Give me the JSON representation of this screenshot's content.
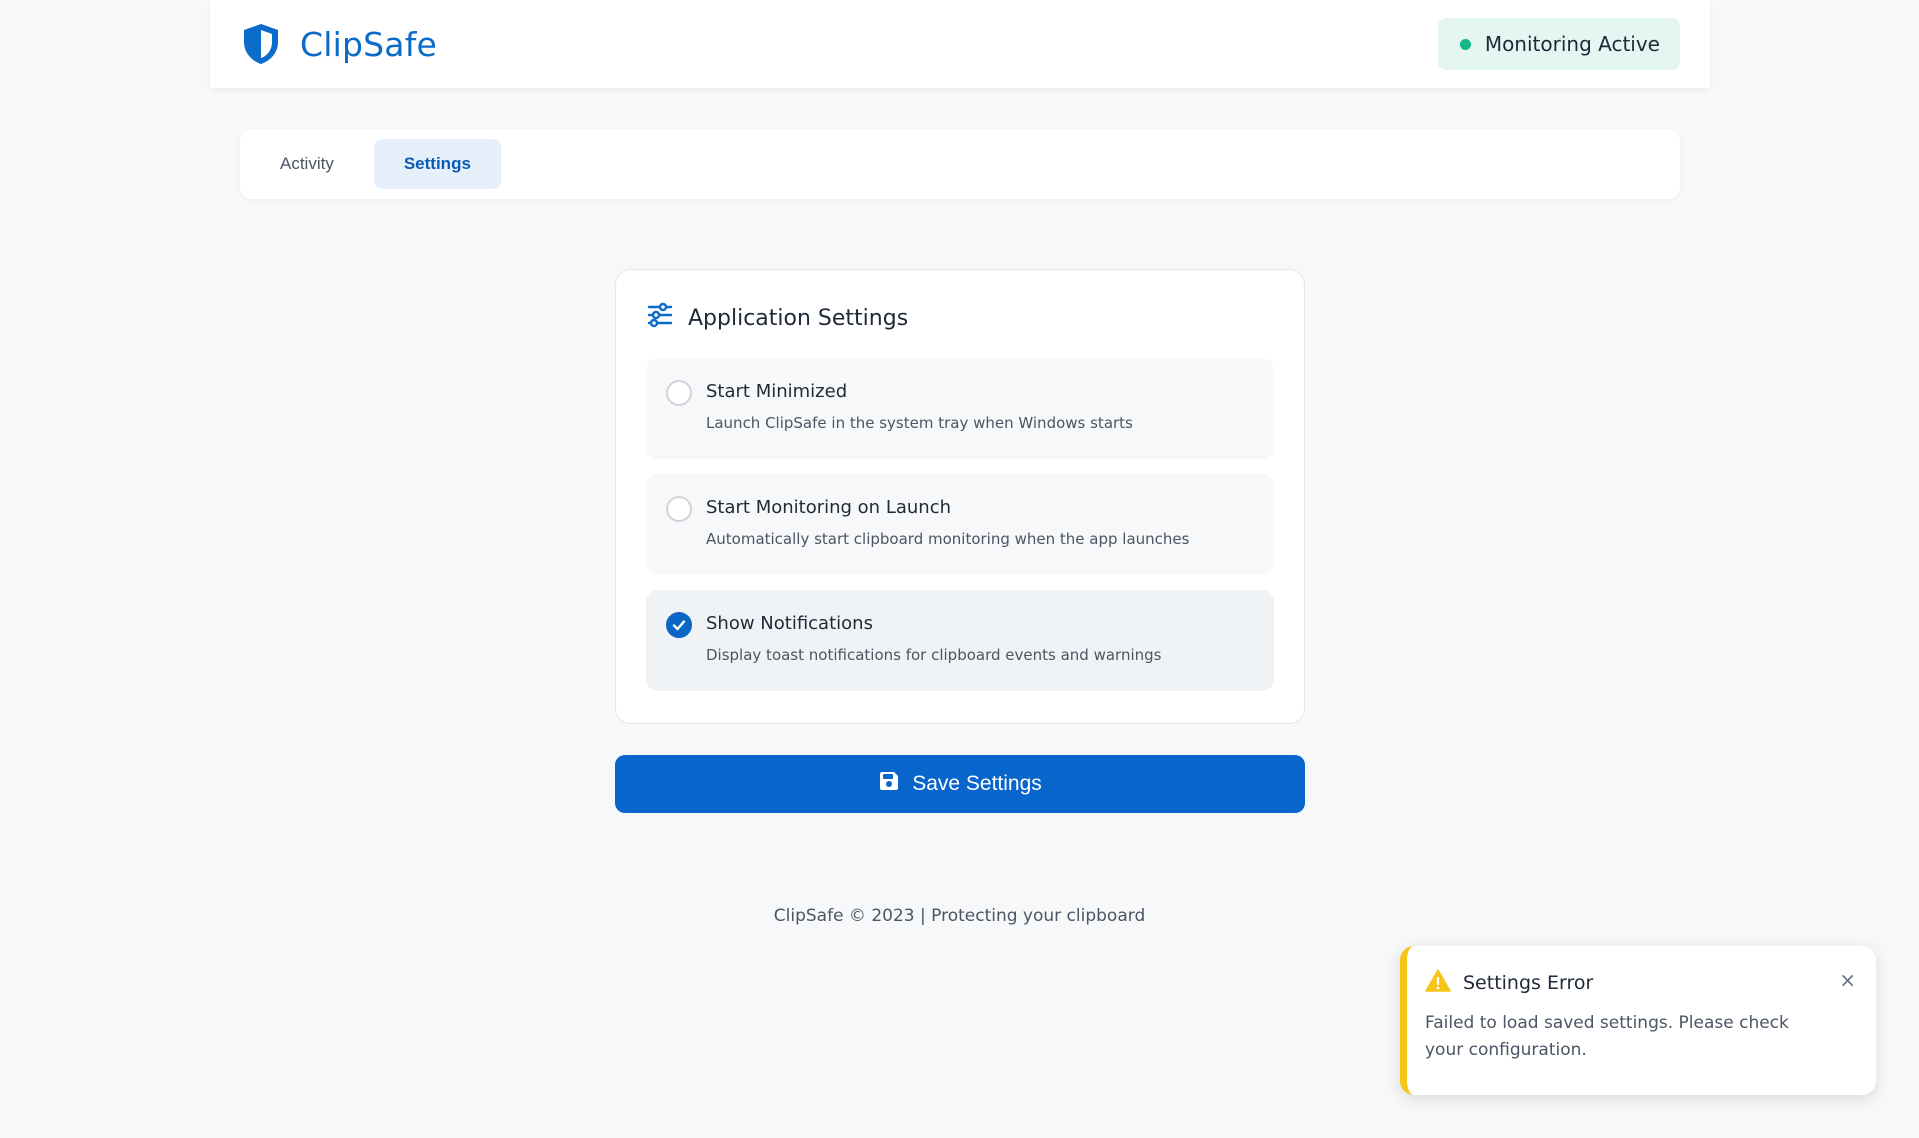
{
  "app": {
    "name": "ClipSafe",
    "brand_color": "#0b6bc8"
  },
  "header": {
    "status_text": "Monitoring Active",
    "status_color": "#12b886"
  },
  "tabs": [
    {
      "label": "Activity",
      "active": false
    },
    {
      "label": "Settings",
      "active": true
    }
  ],
  "settings_card": {
    "title": "Application Settings",
    "icon": "sliders-icon",
    "options": [
      {
        "label": "Start Minimized",
        "description": "Launch ClipSafe in the system tray when Windows starts",
        "checked": false
      },
      {
        "label": "Start Monitoring on Launch",
        "description": "Automatically start clipboard monitoring when the app launches",
        "checked": false
      },
      {
        "label": "Show Notifications",
        "description": "Display toast notifications for clipboard events and warnings",
        "checked": true
      }
    ]
  },
  "save_button": {
    "label": "Save Settings",
    "icon": "floppy-disk-icon",
    "color": "#0865cc"
  },
  "footer": {
    "text": "ClipSafe © 2023 | Protecting your clipboard"
  },
  "toast": {
    "title": "Settings Error",
    "message": "Failed to load saved settings. Please check your configuration.",
    "icon": "warning-icon",
    "close": "×",
    "accent_color": "#f5c518"
  }
}
